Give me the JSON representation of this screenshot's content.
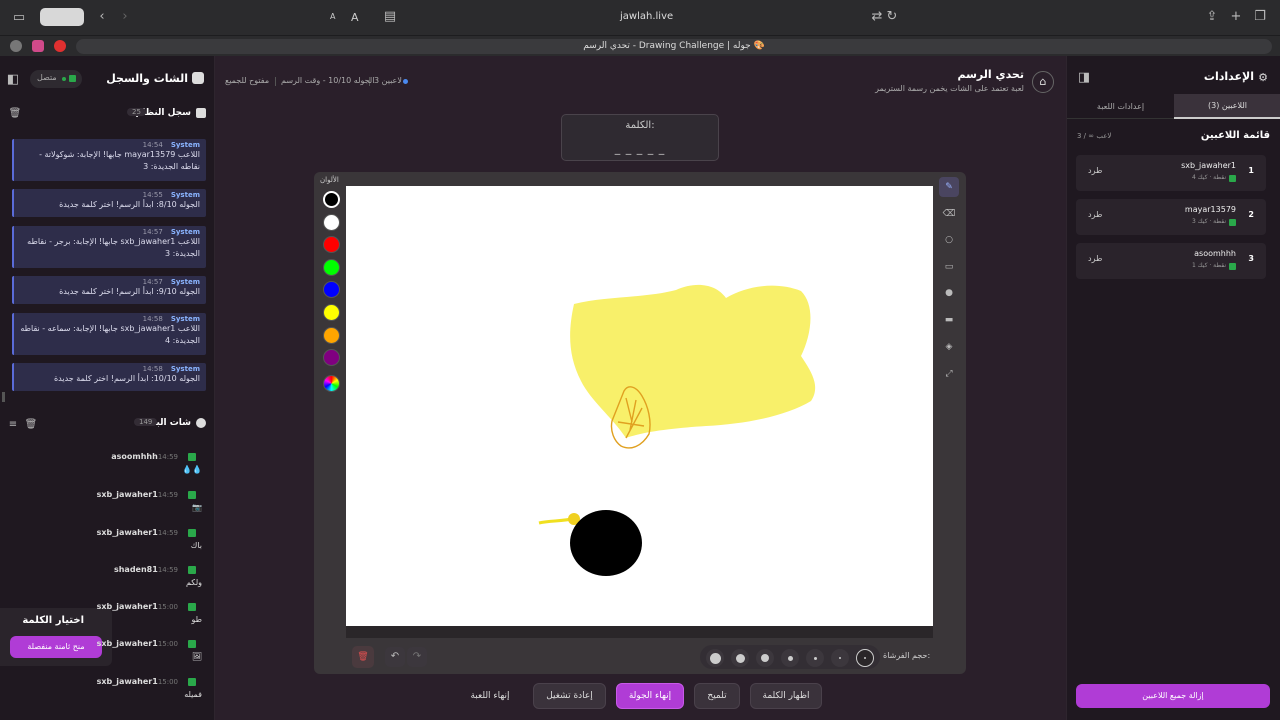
{
  "browser": {
    "url": "jawlah.live",
    "tab_title": "تحدي الرسم - Drawing Challenge | جوله 🎨",
    "reader_a": "A"
  },
  "left_panel": {
    "title": "الشات والسجل",
    "status": "متصل",
    "system_log": {
      "title": "سجل النظام",
      "count": "25",
      "entries": [
        {
          "sender": "System",
          "time": "14:54",
          "text": "اللاعب mayar13579 جابها! الإجابة: شوكولاتة - نقاطه الجديدة: 3"
        },
        {
          "sender": "System",
          "time": "14:55",
          "text": "الجوله 8/10: ابدأ الرسم! اختر كلمة جديدة"
        },
        {
          "sender": "System",
          "time": "14:57",
          "text": "اللاعب sxb_jawaher1 جابها! الإجابة: برجر - نقاطه الجديدة: 3"
        },
        {
          "sender": "System",
          "time": "14:57",
          "text": "الجوله 9/10: ابدأ الرسم! اختر كلمة جديدة"
        },
        {
          "sender": "System",
          "time": "14:58",
          "text": "اللاعب sxb_jawaher1 جابها! الإجابة: سماعه - نقاطه الجديدة: 4"
        },
        {
          "sender": "System",
          "time": "14:58",
          "text": "الجوله 10/10: ابدأ الرسم! اختر كلمة جديدة"
        }
      ]
    },
    "stream_chat": {
      "title": "شات البث",
      "count": "149",
      "messages": [
        {
          "user": "asoomhhh",
          "time": "14:59",
          "text": "💧💧"
        },
        {
          "user": "sxb_jawaher1",
          "time": "14:59",
          "text": "📷"
        },
        {
          "user": "sxb_jawaher1",
          "time": "14:59",
          "text": "باك"
        },
        {
          "user": "shaden81",
          "time": "14:59",
          "text": "ولكم"
        },
        {
          "user": "sxb_jawaher1",
          "time": "15:00",
          "text": "طو"
        },
        {
          "user": "sxb_jawaher1",
          "time": "15:00",
          "text": "🖼"
        },
        {
          "user": "sxb_jawaher1",
          "time": "15:00",
          "text": "فميله"
        }
      ]
    },
    "word_choice": {
      "title": "اختيار الكلمة",
      "button": "منح ثامنة منفصلة"
    }
  },
  "header": {
    "title": "تحدي الرسم",
    "subtitle": "لعبة تعتمد على الشات يخمن رسمة الستريمر",
    "players_count": "3 لاعبين",
    "round_info": "الجوله 10/10 - وقت الرسم",
    "open_label": "مفتوح للجميع"
  },
  "word_box": {
    "label": "الكلمة:",
    "value": "_ _ _ _ _"
  },
  "canvas": {
    "colors_label": "الألوان",
    "palette": [
      "#000000",
      "#ffffff",
      "#ff0000",
      "#00ff00",
      "#0000ff",
      "#ffff00",
      "#ffa500",
      "#800080"
    ],
    "brush_size_label": "حجم الفرشاة:"
  },
  "actions": {
    "reveal_word": "اظهار الكلمة",
    "hint": "تلميح",
    "end_round": "إنهاء الجولة",
    "restart": "إعادة تشغيل",
    "end_game": "إنهاء اللعبة"
  },
  "settings": {
    "title": "الإعدادات",
    "tab_players": "اللاعبين (3)",
    "tab_game": "إعدادات اللعبة",
    "list_title": "قائمة اللاعبين",
    "list_count": "3 / ∞ لاعب",
    "kick_label": "طرد",
    "players": [
      {
        "rank": "1",
        "name": "sxb_jawaher1",
        "meta": "4 نقطة · كيك"
      },
      {
        "rank": "2",
        "name": "mayar13579",
        "meta": "3 نقطة · كيك"
      },
      {
        "rank": "3",
        "name": "asoomhhh",
        "meta": "1 نقطة · كيك"
      }
    ],
    "remove_all": "إزالة جميع اللاعبين"
  },
  "colors": {
    "accent": "#b03cd6",
    "kick_green": "#2aa84a",
    "system_blue": "#8ab4ff"
  }
}
